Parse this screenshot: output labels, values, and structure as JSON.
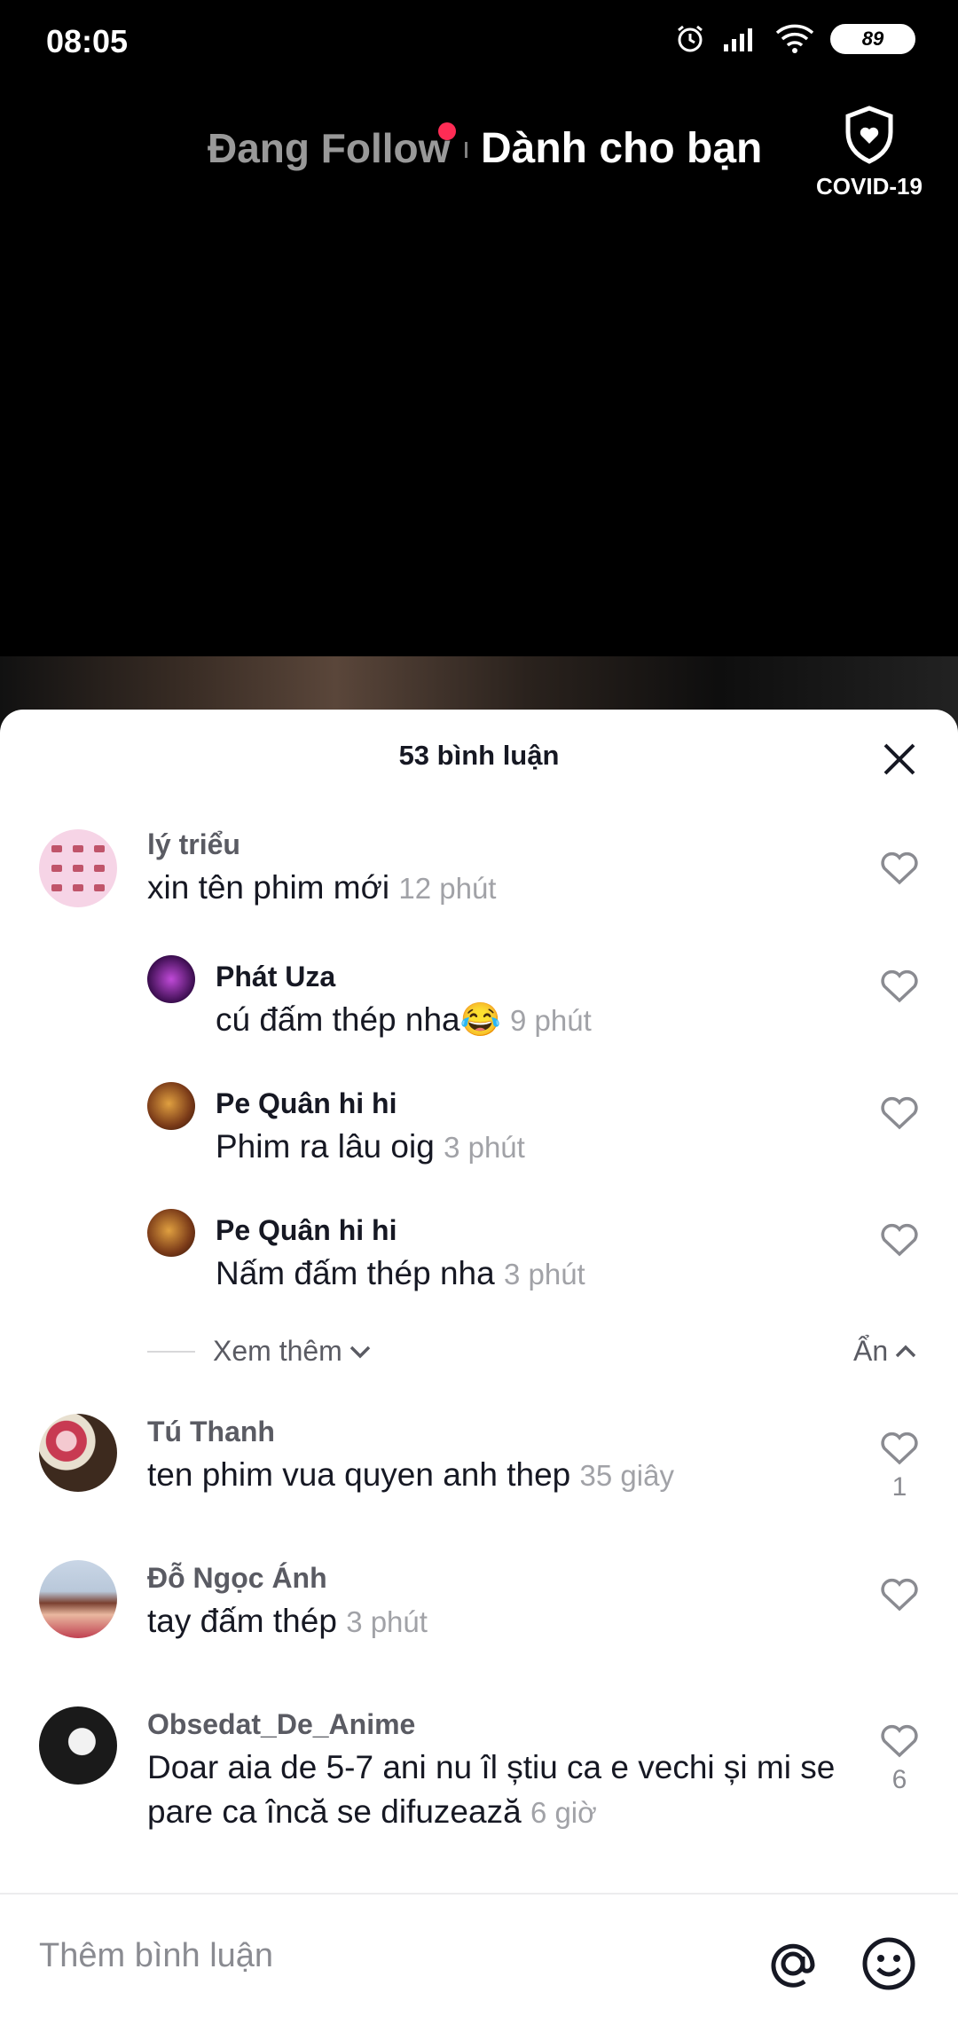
{
  "status": {
    "time": "08:05",
    "battery": "89"
  },
  "tabs": {
    "following": "Đang Follow",
    "for_you": "Dành cho bạn"
  },
  "covid": {
    "label": "COVID-19"
  },
  "sheet": {
    "title": "53 bình luận"
  },
  "comments": [
    {
      "user": "lý triểu",
      "text": "xin tên phim mới",
      "time": "12 phút"
    },
    {
      "user": "Phát Uza",
      "text": "cú đấm thép nha😂",
      "time": "9 phút"
    },
    {
      "user": "Pe Quân hi hi",
      "text": "Phim ra lâu oig",
      "time": "3 phút"
    },
    {
      "user": "Pe Quân hi hi",
      "text": "Nấm đấm thép nha",
      "time": "3 phút"
    },
    {
      "user": "Tú Thanh",
      "text": "ten phim vua quyen anh thep",
      "time": "35 giây",
      "likes": "1"
    },
    {
      "user": "Đỗ Ngọc Ánh",
      "text": "tay đấm thép",
      "time": "3 phút"
    },
    {
      "user": "Obsedat_De_Anime",
      "text": "Doar aia de 5-7 ani nu îl știu ca e vechi și mi se pare ca încă se difuzează",
      "time": "6 giờ",
      "likes": "6"
    }
  ],
  "replies": {
    "more_label": "Xem thêm",
    "hide_label": "Ẩn"
  },
  "input": {
    "placeholder": "Thêm bình luận"
  },
  "colors": {
    "accent": "#fe2c55",
    "text": "#161823",
    "muted": "#a1a2a7"
  }
}
